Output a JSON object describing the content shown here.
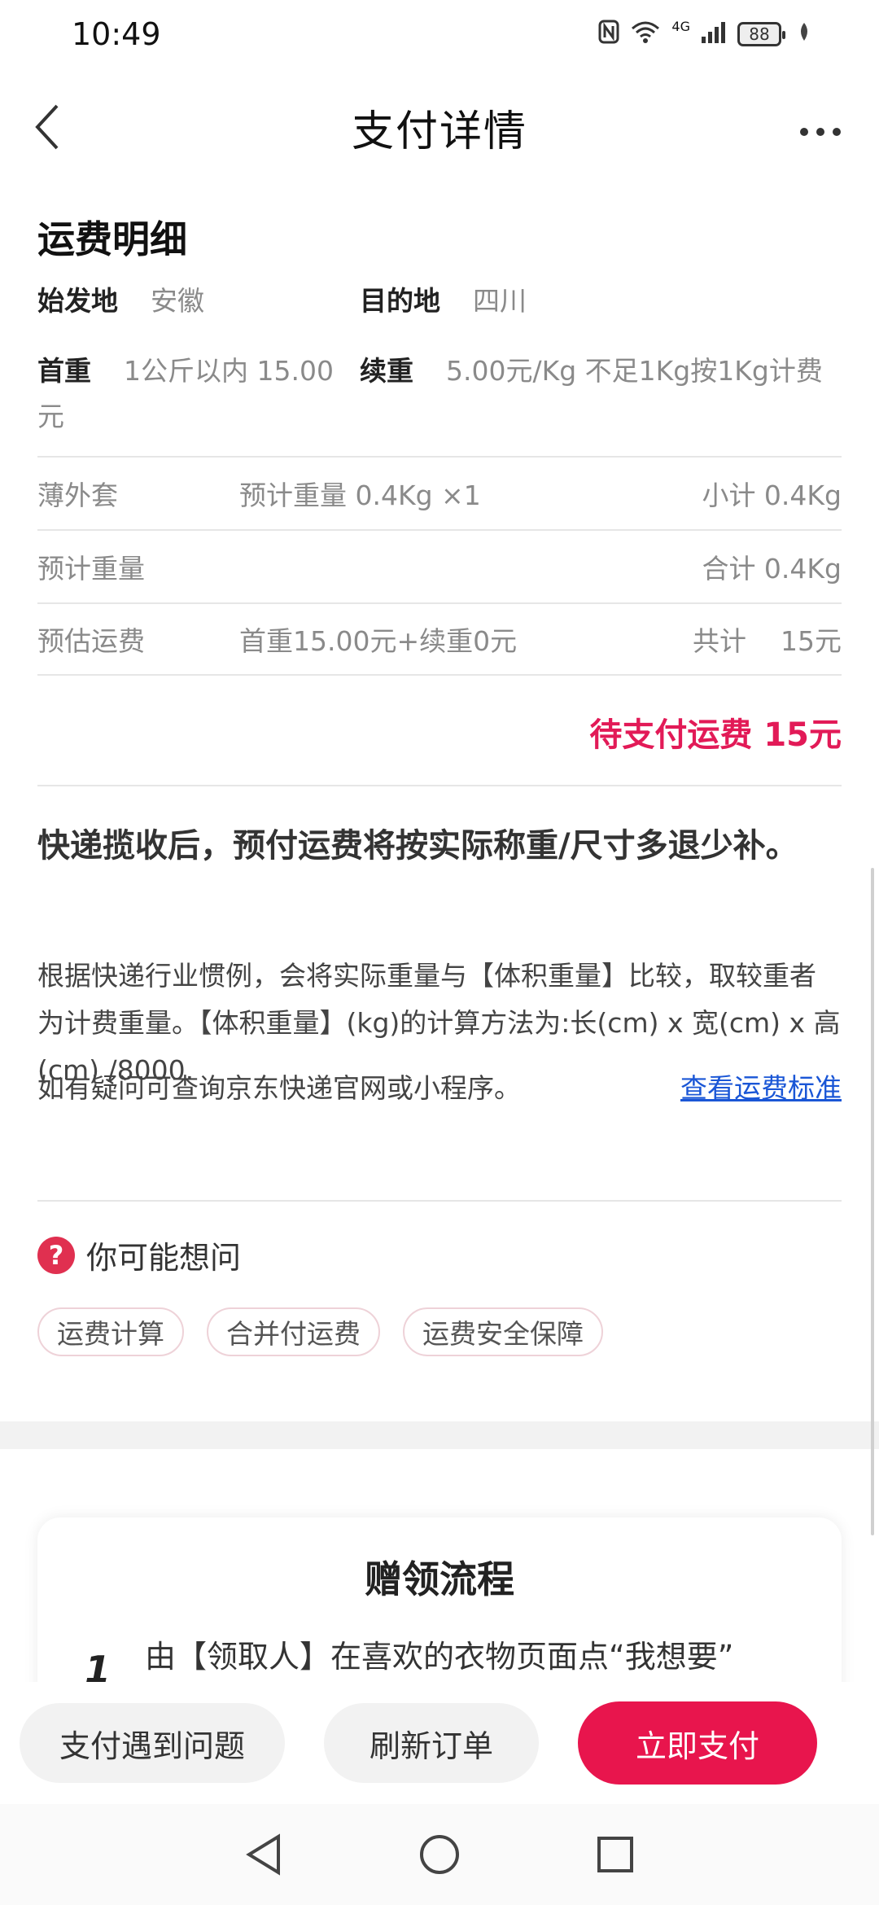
{
  "status_bar": {
    "time": "10:49",
    "network": "4G",
    "battery": "88"
  },
  "nav": {
    "title": "支付详情",
    "more": "•••"
  },
  "freight": {
    "section_title": "运费明细",
    "origin_label": "始发地",
    "origin_value": "安徽",
    "dest_label": "目的地",
    "dest_value": "四川",
    "first_weight_label": "首重",
    "first_weight_value": "1公斤以内 15.00元",
    "add_weight_label": "续重",
    "add_weight_value": "5.00元/Kg 不足1Kg按1Kg计费",
    "rows": [
      {
        "c1": "薄外套",
        "c2": "预计重量 0.4Kg ×1",
        "c3": "小计 0.4Kg"
      },
      {
        "c1": "预计重量",
        "c2": "",
        "c3": "合计 0.4Kg"
      },
      {
        "c1": "预估运费",
        "c2": "首重15.00元+续重0元",
        "c3": "共计    15元"
      }
    ],
    "due": "待支付运费 15元"
  },
  "refund": {
    "title": "快递揽收后，预付运费将按实际称重/尺寸多退少补。",
    "desc": "根据快递行业惯例，会将实际重量与【体积重量】比较，取较重者为计费重量。【体积重量】(kg)的计算方法为:长(cm) x 宽(cm) x 高(cm) /8000.",
    "query_text": "如有疑问可查询京东快递官网或小程序。",
    "query_link": "查看运费标准"
  },
  "faq": {
    "title": "你可能想问",
    "icon": "?",
    "chips": [
      "运费计算",
      "合并付运费",
      "运费安全保障"
    ]
  },
  "flow": {
    "title": "赠领流程",
    "step_num": "1",
    "step_text": "由【领取人】在喜欢的衣物页面点“我想要”"
  },
  "actions": {
    "issue": "支付遇到问题",
    "refresh": "刷新订单",
    "pay": "立即支付"
  },
  "colors": {
    "accent": "#e8154d",
    "due": "#e21a57",
    "link": "#1a56d6"
  }
}
